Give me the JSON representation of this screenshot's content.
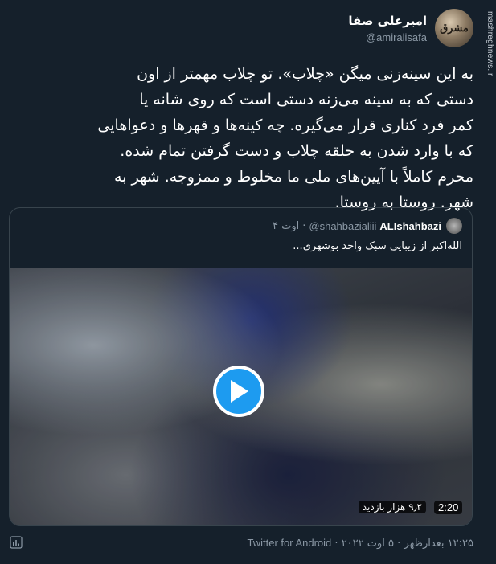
{
  "watermark": "mashreghnews.ir",
  "author": {
    "display_name": "امیرعلی صفا",
    "handle": "@amiralisafa",
    "avatar_text": "مشرق"
  },
  "tweet": {
    "lines": [
      "به این سینه‌زنی میگن «چلاب». تو چلاب مهمتر از اون",
      "دستی که به سینه می‌زنه دستی است که روی شانه یا",
      "کمر فرد کناری قرار می‌گیره. چه کینه‌ها و قهرها و دعواهایی",
      "که با وارد شدن به حلقه چلاب و دست گرفتن تمام شده.",
      "محرم کاملاً با آیین‌های ملی ما مخلوط و ممزوجه. شهر به",
      "شهر. روستا به روستا."
    ]
  },
  "quote": {
    "display_name": "ALIshahbazi",
    "handle": "@shahbazialiii",
    "separator": "·",
    "date": "۴ اوت",
    "text": "الله‌اکبر از زیبایی سبک واحد بوشهری...",
    "video": {
      "duration": "2:20",
      "views": "۹٫۲ هزار بازدید"
    }
  },
  "footer": {
    "time": "۱۲:۲۵ بعدازظهر",
    "separator1": "·",
    "date": "۵ اوت ۲۰۲۲",
    "separator2": "·",
    "app": "Twitter for Android"
  },
  "colors": {
    "background": "#15202b",
    "accent": "#1d9bf0",
    "secondary_text": "#8b98a5",
    "border": "#38444d"
  },
  "icons": [
    "play-icon",
    "analytics-icon"
  ]
}
